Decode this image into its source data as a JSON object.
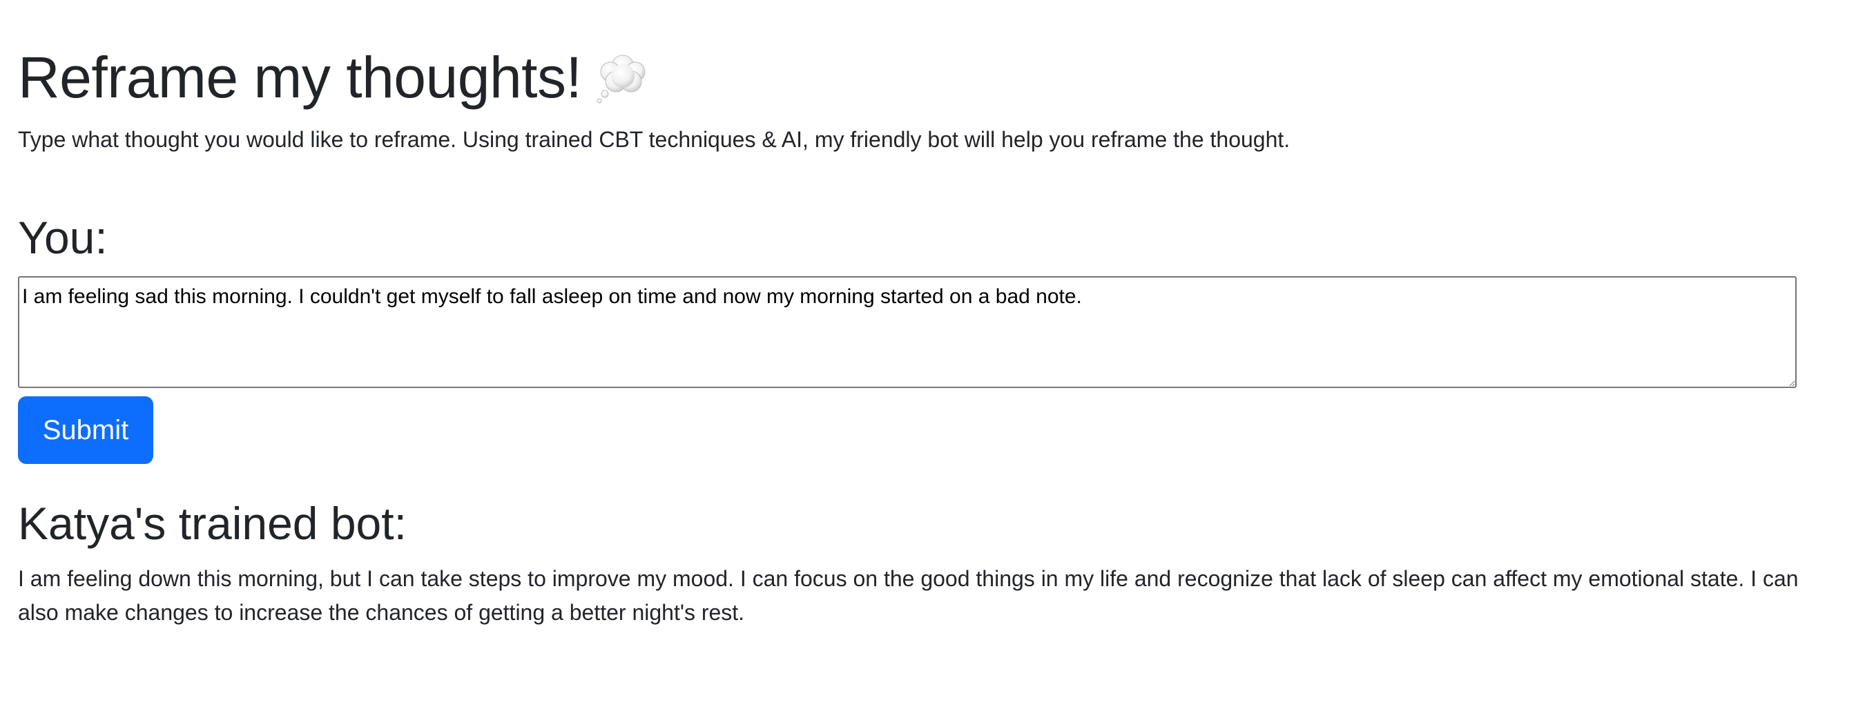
{
  "header": {
    "title": "Reframe my thoughts!",
    "title_icon": "thought-balloon-icon",
    "intro": "Type what thought you would like to reframe. Using trained CBT techniques & AI, my friendly bot will help you reframe the thought."
  },
  "user_section": {
    "heading": "You:",
    "input_value": "I am feeling sad this morning. I couldn't get myself to fall asleep on time and now my morning started on a bad note.",
    "submit_label": "Submit"
  },
  "bot_section": {
    "heading": "Katya's trained bot:",
    "response": "I am feeling down this morning, but I can take steps to improve my mood. I can focus on the good things in my life and recognize that lack of sleep can affect my emotional state. I can also make changes to increase the chances of getting a better night's rest."
  },
  "colors": {
    "primary": "#0d6efd",
    "text": "#212529"
  }
}
